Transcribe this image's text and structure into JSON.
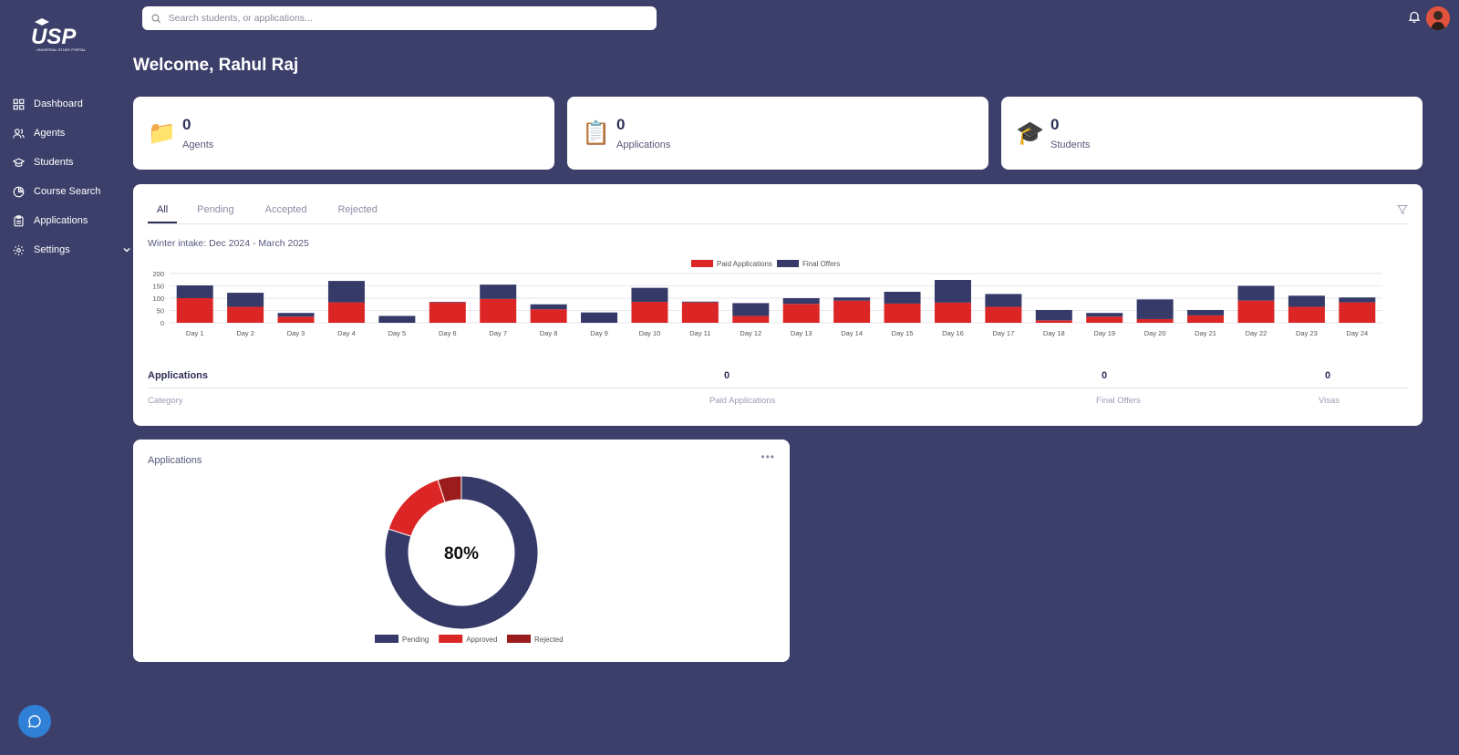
{
  "brand": {
    "logo_text": "USP",
    "logo_sub": "UNIVERSAL STUDY PORTAL"
  },
  "sidebar": {
    "items": [
      {
        "label": "Dashboard",
        "icon": "grid-icon"
      },
      {
        "label": "Agents",
        "icon": "users-icon"
      },
      {
        "label": "Students",
        "icon": "graduation-cap-icon"
      },
      {
        "label": "Course Search",
        "icon": "pie-chart-icon"
      },
      {
        "label": "Applications",
        "icon": "clipboard-icon"
      },
      {
        "label": "Settings",
        "icon": "gear-icon"
      }
    ]
  },
  "search": {
    "placeholder": "Search students, or applications..."
  },
  "welcome": "Welcome, Rahul Raj",
  "stats": [
    {
      "icon": "📁",
      "value": "0",
      "label": "Agents"
    },
    {
      "icon": "📋",
      "value": "0",
      "label": "Applications"
    },
    {
      "icon": "🎓",
      "value": "0",
      "label": "Students"
    }
  ],
  "tabs": [
    "All",
    "Pending",
    "Accepted",
    "Rejected"
  ],
  "intake": "Winter intake: Dec 2024 - March 2025",
  "chart_data": {
    "type": "bar",
    "stacked": true,
    "categories": [
      "Day 1",
      "Day 2",
      "Day 3",
      "Day 4",
      "Day 5",
      "Day 6",
      "Day 7",
      "Day 8",
      "Day 9",
      "Day 10",
      "Day 11",
      "Day 12",
      "Day 13",
      "Day 14",
      "Day 15",
      "Day 16",
      "Day 17",
      "Day 18",
      "Day 19",
      "Day 20",
      "Day 21",
      "Day 22",
      "Day 23",
      "Day 24"
    ],
    "series": [
      {
        "name": "Paid Applications",
        "color": "#dc2626",
        "values": [
          100,
          65,
          25,
          83,
          0,
          83,
          97,
          55,
          0,
          85,
          83,
          28,
          77,
          90,
          78,
          82,
          65,
          10,
          25,
          15,
          30,
          90,
          65,
          83
        ]
      },
      {
        "name": "Final Offers",
        "color": "#363a68",
        "values": [
          52,
          57,
          15,
          87,
          28,
          2,
          58,
          20,
          42,
          57,
          3,
          52,
          23,
          13,
          48,
          92,
          52,
          42,
          15,
          80,
          22,
          60,
          45,
          20
        ]
      }
    ],
    "ylim": [
      0,
      200
    ],
    "yticks": [
      0,
      50,
      100,
      150,
      200
    ],
    "legend": "top-center",
    "grid": true
  },
  "summary": {
    "row_label": "Applications",
    "paid": "0",
    "offers": "0",
    "visas": "0",
    "col_category": "Category",
    "col_paid": "Paid Applications",
    "col_offers": "Final Offers",
    "col_visas": "Visas"
  },
  "donut": {
    "title": "Applications",
    "center": "80%",
    "slices": [
      {
        "name": "Pending",
        "value": 80,
        "color": "#363a68"
      },
      {
        "name": "Approved",
        "value": 15,
        "color": "#dc2626"
      },
      {
        "name": "Rejected",
        "value": 5,
        "color": "#9b1c1c"
      }
    ]
  }
}
